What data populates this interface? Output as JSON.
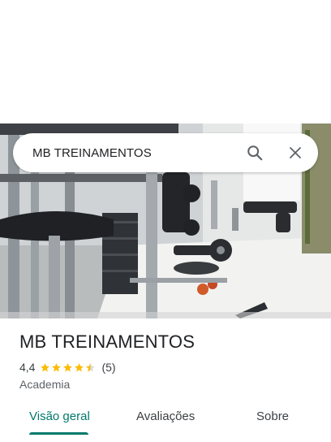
{
  "search": {
    "query": "MB TREINAMENTOS"
  },
  "place": {
    "name": "MB TREINAMENTOS",
    "rating": "4,4",
    "stars": 4.4,
    "review_count": "(5)",
    "category": "Academia"
  },
  "tabs": [
    {
      "label": "Visão geral",
      "active": true
    },
    {
      "label": "Avaliações",
      "active": false
    },
    {
      "label": "Sobre",
      "active": false
    }
  ],
  "icons": {
    "search": "search-icon",
    "close": "close-icon",
    "star": "star-icon"
  },
  "colors": {
    "accent": "#00796b",
    "star": "#fbbc04",
    "star_empty": "#dadce0",
    "text": "#202124",
    "muted": "#5f6368"
  }
}
